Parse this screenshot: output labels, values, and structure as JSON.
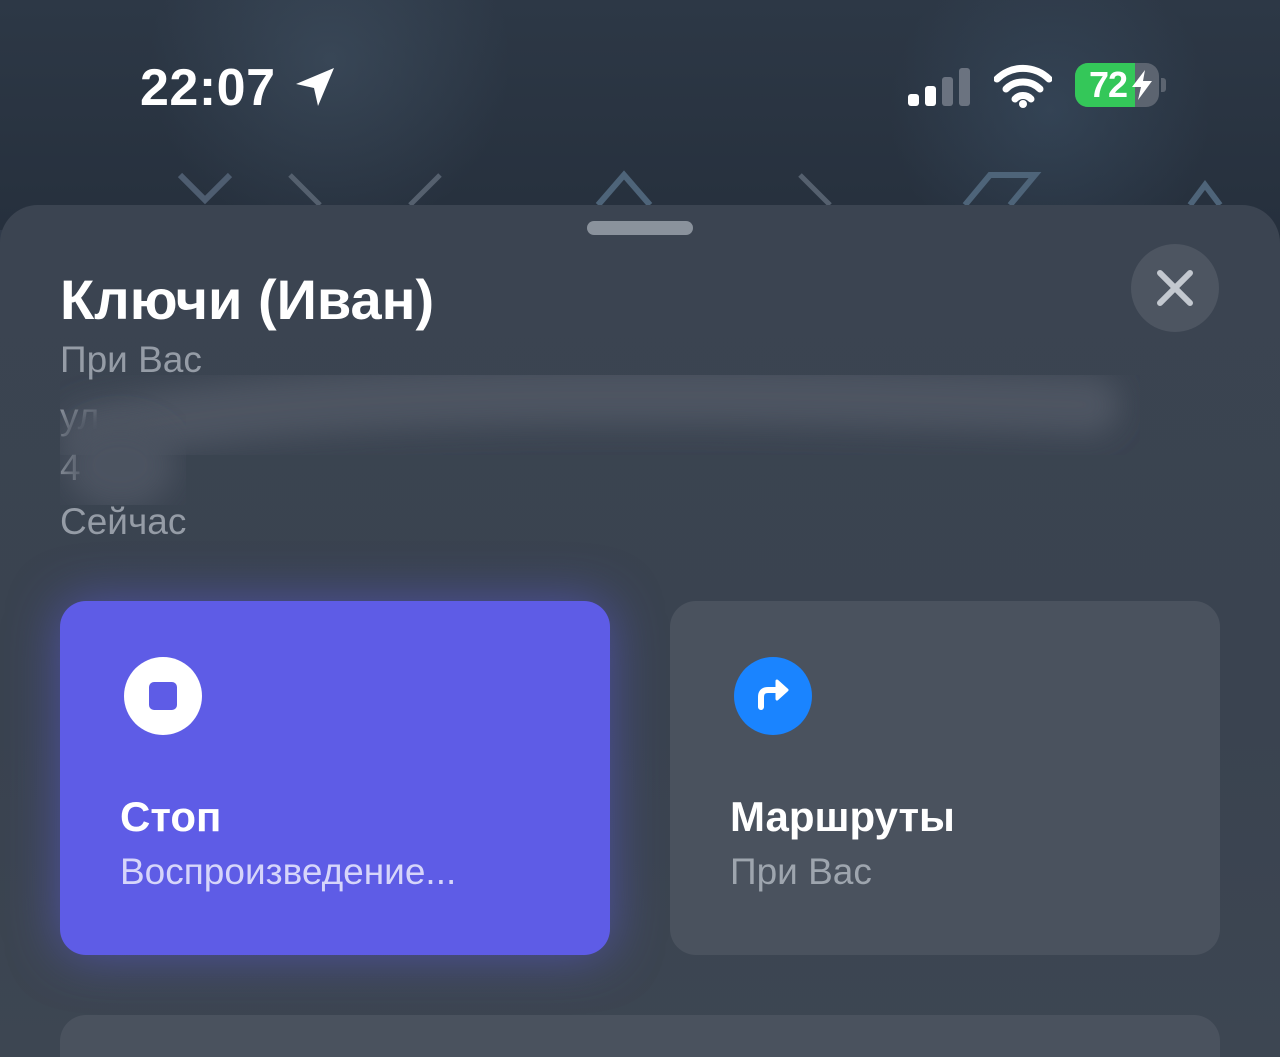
{
  "status_bar": {
    "time": "22:07",
    "battery_percent": "72",
    "battery_level": 0.72,
    "icons": [
      "location-arrow-icon",
      "signal-icon",
      "wifi-icon",
      "battery-charging-icon"
    ]
  },
  "item": {
    "title": "Ключи (Иван)",
    "status": "При Вас",
    "address_line1": "ул",
    "address_line2": "4",
    "updated": "Сейчас"
  },
  "actions": {
    "stop": {
      "title": "Стоп",
      "subtitle": "Воспроизведение...",
      "icon": "stop-icon",
      "color": "#5e5ce6"
    },
    "routes": {
      "title": "Маршруты",
      "subtitle": "При Вас",
      "icon": "directions-arrow-icon",
      "color": "#1a84ff"
    }
  },
  "colors": {
    "accent": "#5e5ce6",
    "battery_green": "#34c759",
    "route_blue": "#1a84ff"
  }
}
